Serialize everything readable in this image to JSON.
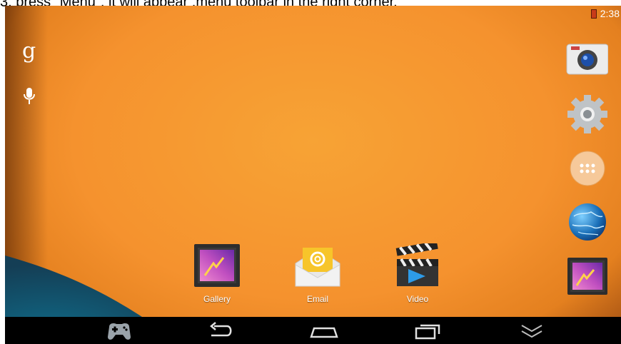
{
  "caption": "3, press \"Menu\", it will appear ,menu toolbar in the right corner.",
  "status_bar": {
    "time": "2:38",
    "battery_icon": "battery-icon"
  },
  "search_bar": {
    "google_glyph": "g",
    "voice_icon": "microphone-icon"
  },
  "apps": [
    {
      "label": "Gallery",
      "icon": "gallery-icon"
    },
    {
      "label": "Email",
      "icon": "email-icon"
    },
    {
      "label": "Video",
      "icon": "video-icon"
    }
  ],
  "dock": {
    "items": [
      {
        "name": "camera",
        "icon": "camera-icon"
      },
      {
        "name": "settings",
        "icon": "gear-icon"
      },
      {
        "name": "all-apps",
        "icon": "app-drawer-icon"
      },
      {
        "name": "browser",
        "icon": "globe-icon"
      },
      {
        "name": "gallery",
        "icon": "gallery-icon"
      }
    ]
  },
  "navbar": {
    "items": [
      {
        "name": "game",
        "icon": "gamepad-icon"
      },
      {
        "name": "back",
        "icon": "back-icon"
      },
      {
        "name": "home",
        "icon": "home-icon"
      },
      {
        "name": "recent-apps",
        "icon": "recent-apps-icon"
      },
      {
        "name": "collapse",
        "icon": "chevron-down-icon"
      }
    ]
  },
  "colors": {
    "wallpaper": "#f5922e",
    "wave": "#1b5f7a",
    "navbar": "#000000"
  }
}
